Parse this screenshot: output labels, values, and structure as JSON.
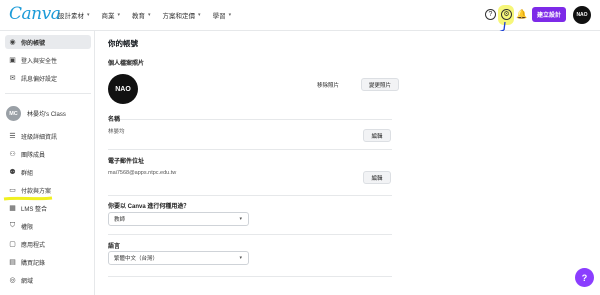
{
  "header": {
    "logo": "Canva",
    "nav": [
      "設計素材",
      "商業",
      "教育",
      "方案和定價",
      "學習"
    ],
    "create_label": "建立設計",
    "help_icon": "question-icon",
    "settings_icon": "gear-icon",
    "notif_icon": "bell-icon",
    "avatar_text": "NAO"
  },
  "sidebar": {
    "items": [
      {
        "label": "你的帳號",
        "icon": "user-icon"
      },
      {
        "label": "登入與安全性",
        "icon": "lock-icon"
      },
      {
        "label": "訊息偏好設定",
        "icon": "mail-icon"
      }
    ],
    "team": {
      "avatar": "MC",
      "name": "林晏均's Class"
    },
    "team_items": [
      {
        "label": "班級詳細資訊",
        "icon": "list-icon"
      },
      {
        "label": "團隊成員",
        "icon": "people-icon"
      },
      {
        "label": "群組",
        "icon": "group-icon"
      },
      {
        "label": "付款與方案",
        "icon": "card-icon"
      },
      {
        "label": "LMS 整合",
        "icon": "grid-icon"
      },
      {
        "label": "權限",
        "icon": "shield-icon"
      },
      {
        "label": "應用程式",
        "icon": "apps-icon"
      },
      {
        "label": "購買記錄",
        "icon": "receipt-icon"
      },
      {
        "label": "網域",
        "icon": "globe-icon"
      }
    ]
  },
  "main": {
    "title": "你的帳號",
    "photo": {
      "label": "個人檔案照片",
      "remove": "移除照片",
      "change": "變更照片",
      "avatar_text": "NAO"
    },
    "name": {
      "label": "名稱",
      "value": "林晏均",
      "edit": "編輯"
    },
    "email": {
      "label": "電子郵件位址",
      "value": "mai7568@apps.ntpc.edu.tw",
      "edit": "編輯"
    },
    "usage": {
      "label": "你要以 Canva 進行何種用途？",
      "value": "教師"
    },
    "language": {
      "label": "語言",
      "value": "繁體中文（台灣）"
    }
  }
}
